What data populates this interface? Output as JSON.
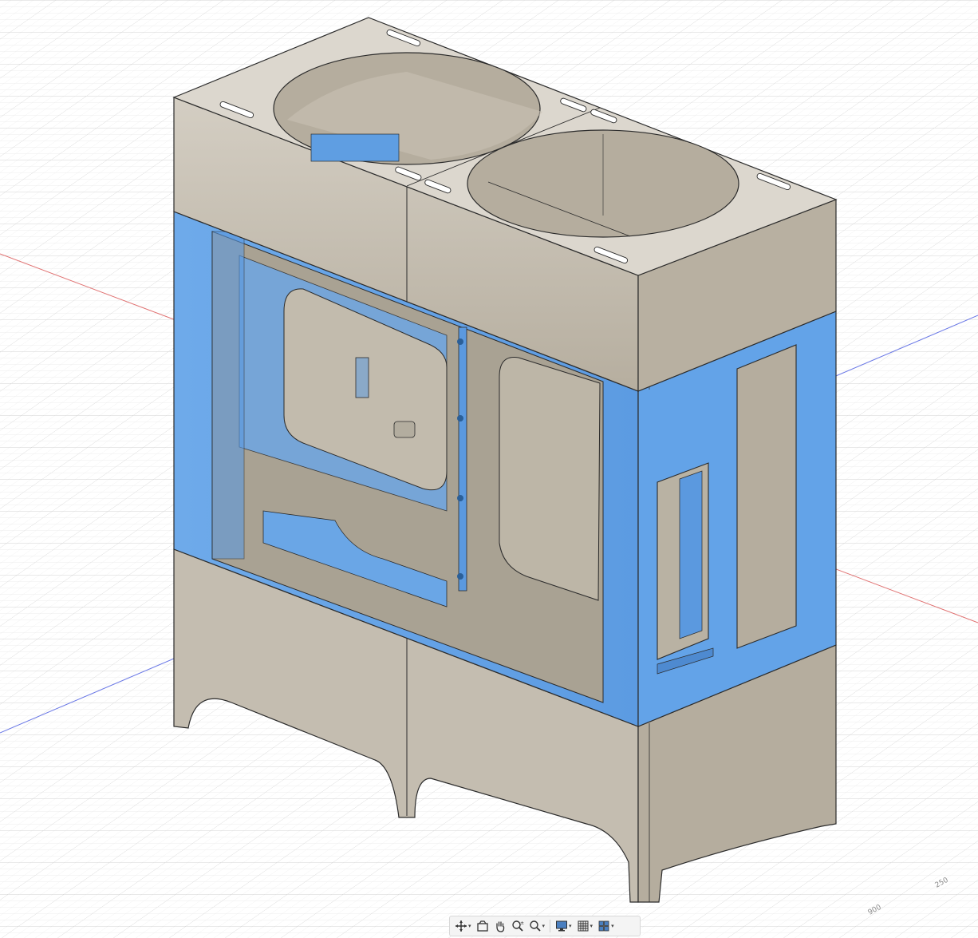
{
  "app": {
    "view": "3D model viewport",
    "model_colors": {
      "panel": "#c9c2b5",
      "panel_light": "#d6d0c6",
      "panel_dark": "#a9a293",
      "selected": "#6aa8ea",
      "selected_dark": "#4d8fd9",
      "edge": "#2b2b2b",
      "grid_major": "#c8c8c8",
      "grid_minor": "#e4e4e4",
      "axis_x": "#e06060",
      "axis_y": "#5a68e0"
    }
  },
  "grid_labels": {
    "label_a": "250",
    "label_b": "900"
  },
  "toolbar": {
    "items": [
      {
        "name": "orbit",
        "icon": "orbit-icon",
        "has_dropdown": true
      },
      {
        "name": "look-at",
        "icon": "look-at-icon",
        "has_dropdown": false
      },
      {
        "name": "pan",
        "icon": "hand-pan-icon",
        "has_dropdown": false
      },
      {
        "name": "zoom",
        "icon": "zoom-icon",
        "has_dropdown": false
      },
      {
        "name": "fit",
        "icon": "zoom-window-icon",
        "has_dropdown": true
      },
      {
        "name": "display-settings",
        "icon": "display-monitor-icon",
        "has_dropdown": true
      },
      {
        "name": "grid-snaps",
        "icon": "grid-icon",
        "has_dropdown": true
      },
      {
        "name": "viewports",
        "icon": "viewports-icon",
        "has_dropdown": true
      }
    ],
    "caret": "▾"
  }
}
